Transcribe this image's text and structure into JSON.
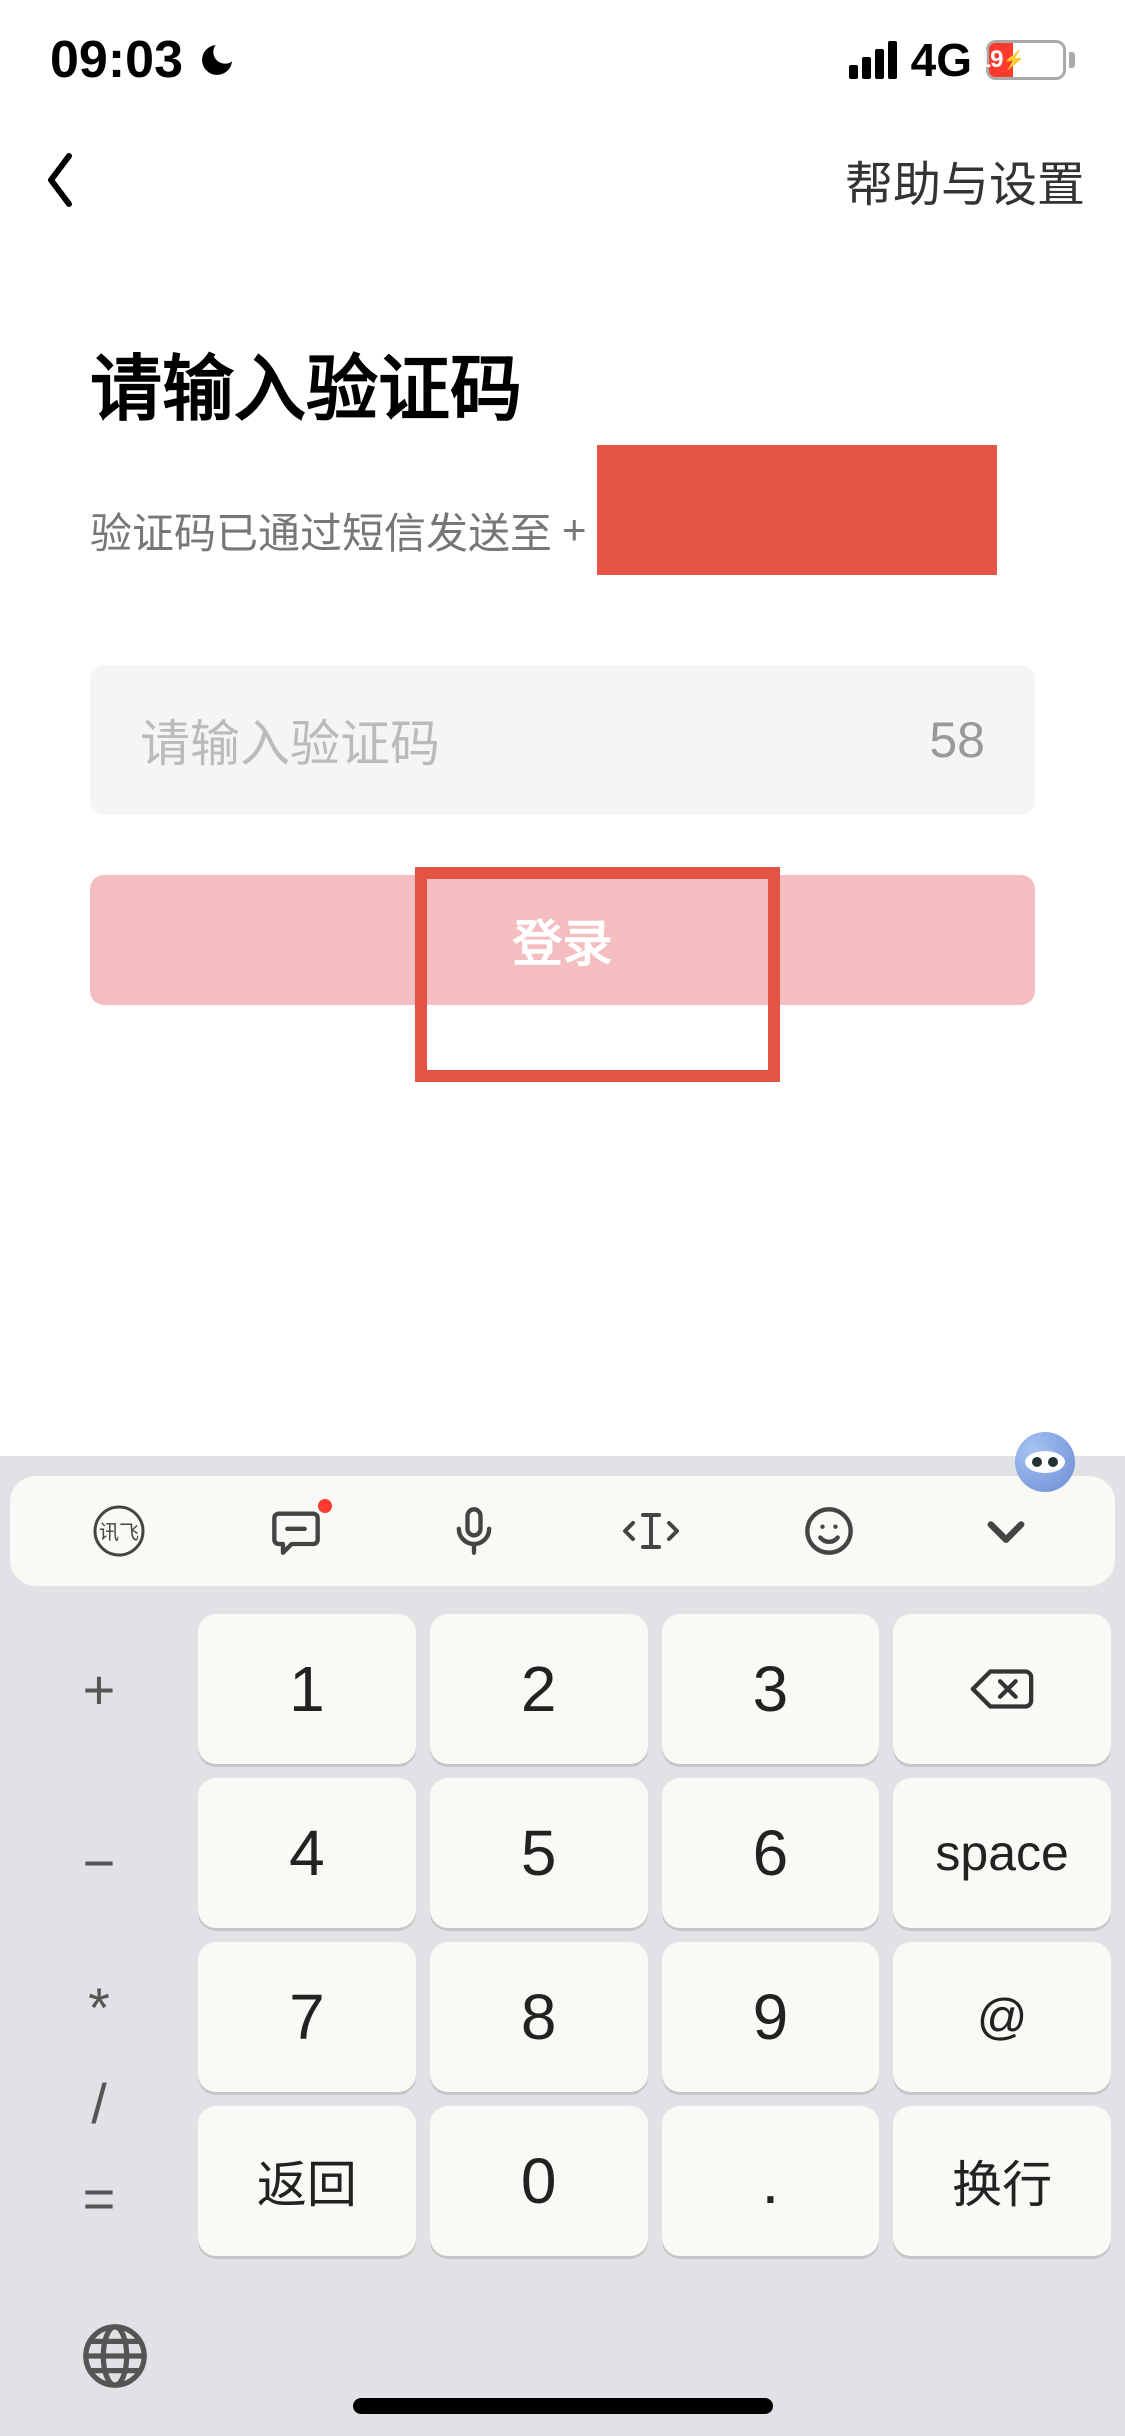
{
  "status_bar": {
    "time": "09:03",
    "network_type": "4G",
    "battery_percent": "19"
  },
  "nav": {
    "help_settings": "帮助与设置"
  },
  "page": {
    "title": "请输入验证码",
    "subtitle_prefix": "验证码已通过短信发送至",
    "phone_prefix": "+",
    "input_placeholder": "请输入验证码",
    "countdown": "58",
    "login_label": "登录"
  },
  "toolbar": {
    "brand_label": "讯飞"
  },
  "keyboard": {
    "side": {
      "plus": "+",
      "minus": "−",
      "star": "*",
      "slash": "/",
      "equals": "="
    },
    "keys": {
      "k1": "1",
      "k2": "2",
      "k3": "3",
      "k4": "4",
      "k5": "5",
      "k6": "6",
      "k7": "7",
      "k8": "8",
      "k9": "9",
      "k0": "0",
      "dot": "."
    },
    "func": {
      "return": "返回",
      "space": "space",
      "at": "@",
      "newline": "换行"
    }
  }
}
